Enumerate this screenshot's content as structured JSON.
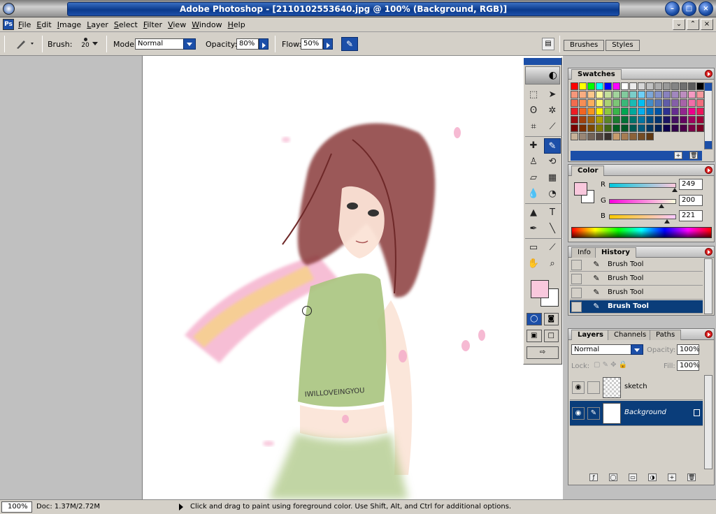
{
  "window": {
    "title": "Adobe Photoshop - [2110102553640.jpg @ 100% (Background, RGB)]"
  },
  "menu": [
    "File",
    "Edit",
    "Image",
    "Layer",
    "Select",
    "Filter",
    "View",
    "Window",
    "Help"
  ],
  "options": {
    "brush_label": "Brush:",
    "brush_size": "20",
    "mode_label": "Mode:",
    "mode_value": "Normal",
    "opacity_label": "Opacity:",
    "opacity_value": "80%",
    "flow_label": "Flow:",
    "flow_value": "50%"
  },
  "palette_well": {
    "tabs": [
      "Brushes",
      "Styles"
    ]
  },
  "toolbox": {
    "foreground_color": "#f9c8dd",
    "background_color": "#ffffff",
    "tools": [
      "marquee-icon",
      "move-icon",
      "lasso-icon",
      "magic-wand-icon",
      "crop-icon",
      "slice-icon",
      "healing-brush-icon",
      "brush-icon",
      "clone-stamp-icon",
      "history-brush-icon",
      "eraser-icon",
      "gradient-icon",
      "blur-icon",
      "dodge-icon",
      "path-select-icon",
      "type-icon",
      "pen-icon",
      "line-icon",
      "notes-icon",
      "eyedropper-icon",
      "hand-icon",
      "zoom-icon"
    ],
    "active_tool": "brush-icon"
  },
  "swatches": {
    "tab": "Swatches",
    "colors": [
      "#ff0000",
      "#ffff00",
      "#00ff00",
      "#00ffff",
      "#0000ff",
      "#ff00ff",
      "#ffffff",
      "#ebebeb",
      "#d6d6d6",
      "#c2c2c2",
      "#adadad",
      "#999999",
      "#858585",
      "#707070",
      "#5c5c5c",
      "#000000",
      "#f7977a",
      "#f9ad81",
      "#fdc68a",
      "#fff79a",
      "#c4df9b",
      "#a2d39c",
      "#82ca9d",
      "#7bcdc8",
      "#6ecff6",
      "#7ea7d8",
      "#8493ca",
      "#8882be",
      "#a187be",
      "#bc8dbf",
      "#f49ac2",
      "#f6989d",
      "#f26c4f",
      "#f68e55",
      "#fbaf5c",
      "#fff467",
      "#acd372",
      "#7cc576",
      "#3bb878",
      "#1abbb4",
      "#00bff3",
      "#438cca",
      "#5574b9",
      "#605ca8",
      "#855fa8",
      "#a763a8",
      "#f06ea9",
      "#f26d7d",
      "#ed1c24",
      "#f26522",
      "#f7941d",
      "#fff200",
      "#8dc73f",
      "#39b54a",
      "#00a651",
      "#00a99d",
      "#00aeef",
      "#0072bc",
      "#0054a6",
      "#2e3192",
      "#662d91",
      "#92278f",
      "#ec008c",
      "#ed145b",
      "#9e0b0f",
      "#a0410d",
      "#a36209",
      "#aba000",
      "#598527",
      "#1a7b30",
      "#007236",
      "#00746b",
      "#0076a3",
      "#004b80",
      "#003471",
      "#1b1464",
      "#440e62",
      "#630460",
      "#9e005d",
      "#9e0039",
      "#790000",
      "#7b2e00",
      "#7d4900",
      "#827b00",
      "#406618",
      "#005e20",
      "#005826",
      "#005952",
      "#005b7f",
      "#003663",
      "#002157",
      "#0d004c",
      "#32004b",
      "#4b0049",
      "#7b0046",
      "#7a0026"
    ],
    "browns": [
      "#c7b299",
      "#998675",
      "#736357",
      "#534741",
      "#37302d",
      "#c69c6d",
      "#a67c52",
      "#8c6239",
      "#754c24",
      "#603913"
    ]
  },
  "color_panel": {
    "tab": "Color",
    "r_label": "R",
    "r_value": "249",
    "g_label": "G",
    "g_value": "200",
    "b_label": "B",
    "b_value": "221",
    "r_level": 0.976,
    "g_level": 0.784,
    "b_level": 0.867
  },
  "history": {
    "tabs": [
      "Info",
      "History"
    ],
    "items": [
      "Brush Tool",
      "Brush Tool",
      "Brush Tool",
      "Brush Tool"
    ],
    "current_index": 3
  },
  "layers": {
    "tabs": [
      "Layers",
      "Channels",
      "Paths"
    ],
    "blend_mode": "Normal",
    "opacity_label": "Opacity:",
    "opacity_value": "100%",
    "lock_label": "Lock:",
    "fill_label": "Fill:",
    "fill_value": "100%",
    "items": [
      {
        "name": "sketch",
        "selected": false
      },
      {
        "name": "Background",
        "selected": true
      }
    ]
  },
  "status": {
    "zoom": "100%",
    "doc": "Doc: 1.37M/2.72M",
    "hint": "Click and drag to paint using foreground color.  Use Shift, Alt, and Ctrl for additional options."
  }
}
